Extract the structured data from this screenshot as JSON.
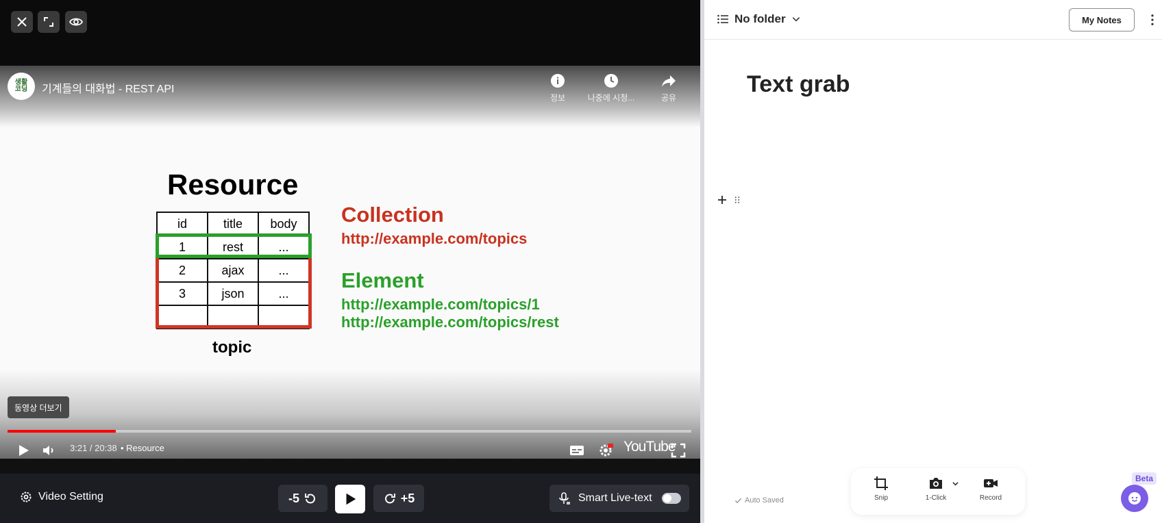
{
  "topbar": {
    "close_icon": "close-icon",
    "expand_icon": "expand-icon",
    "view_icon": "eye-icon"
  },
  "video": {
    "channel_logo_text": "생활\n코딩",
    "title": "기계들의 대화법 - REST API",
    "top_actions": [
      {
        "icon": "info-icon",
        "label": "정보"
      },
      {
        "icon": "clock-icon",
        "label": "나중에 시청..."
      },
      {
        "icon": "share-icon",
        "label": "공유"
      }
    ],
    "slide": {
      "heading": "Resource",
      "table_header": [
        "id",
        "title",
        "body"
      ],
      "table_rows": [
        [
          "1",
          "rest",
          "..."
        ],
        [
          "2",
          "ajax",
          "..."
        ],
        [
          "3",
          "json",
          "..."
        ],
        [
          "",
          "",
          ""
        ]
      ],
      "table_caption": "topic",
      "collection_title": "Collection",
      "collection_url": "http://example.com/topics",
      "element_title": "Element",
      "element_url_1": "http://example.com/topics/1",
      "element_url_2": "http://example.com/topics/rest"
    },
    "more_videos_tooltip": "동영상 더보기",
    "progress_fraction": 0.158,
    "time": "3:21 / 20:38",
    "chapter": "• Resource",
    "wordmark": "YouTube",
    "colors": {
      "progress": "#ff0000",
      "collection": "#c8321f",
      "element": "#2aa02a"
    }
  },
  "bottombar": {
    "video_setting_label": "Video Setting",
    "skip_back_label": "-5",
    "skip_forward_label": "+5",
    "smart_live_text_label": "Smart Live-text",
    "smart_live_text_on": false
  },
  "notes": {
    "folder_label": "No folder",
    "my_notes_label": "My Notes",
    "title": "Text grab",
    "auto_saved_label": "Auto Saved",
    "capture_tools": [
      {
        "icon": "crop-icon",
        "label": "Snip"
      },
      {
        "icon": "camera-icon",
        "label": "1-Click"
      },
      {
        "icon": "video-camera-icon",
        "label": "Record"
      }
    ],
    "beta_label": "Beta",
    "accent_color": "#7b5de6"
  }
}
